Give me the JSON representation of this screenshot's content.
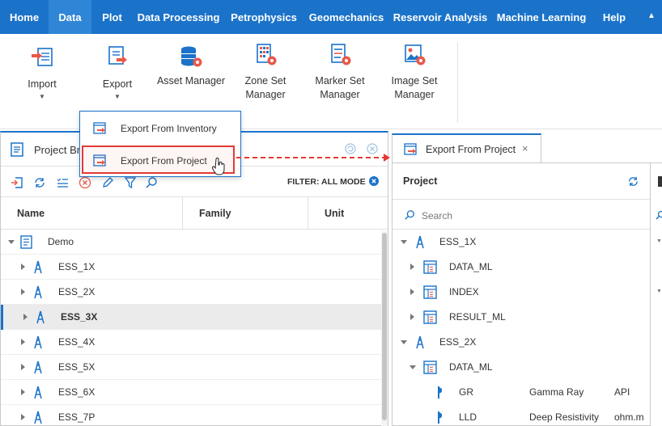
{
  "menubar": {
    "items": [
      "Home",
      "Data",
      "Plot",
      "Data Processing",
      "Petrophysics",
      "Geomechanics",
      "Reservoir Analysis",
      "Machine Learning",
      "Help"
    ],
    "active": "Data",
    "collapse_icon": "caret-up-icon"
  },
  "ribbon": {
    "import_label": "Import",
    "export_label": "Export",
    "asset_manager_label": "Asset Manager",
    "zone_set_label_1": "Zone Set",
    "zone_set_label_2": "Manager",
    "marker_set_label_1": "Marker Set",
    "marker_set_label_2": "Manager",
    "image_set_label_1": "Image Set",
    "image_set_label_2": "Manager"
  },
  "export_menu": {
    "items": [
      "Export From Inventory",
      "Export From Project"
    ],
    "highlighted": "Export From Project"
  },
  "project_browser": {
    "title": "Project Br",
    "filter_label": "FILTER: ALL MODE",
    "columns": [
      "Name",
      "Family",
      "Unit"
    ],
    "root": "Demo",
    "wells": [
      "ESS_1X",
      "ESS_2X",
      "ESS_3X",
      "ESS_4X",
      "ESS_5X",
      "ESS_6X",
      "ESS_7P"
    ],
    "selected": "ESS_3X"
  },
  "export_panel": {
    "tab_label": "Export From Project",
    "tab_close": "×",
    "header": "Project",
    "search_placeholder": "Search",
    "tree": [
      {
        "level": 0,
        "type": "well",
        "name": "ESS_1X",
        "expanded": true
      },
      {
        "level": 1,
        "type": "dataset",
        "name": "DATA_ML",
        "expanded": false
      },
      {
        "level": 1,
        "type": "dataset",
        "name": "INDEX",
        "expanded": false
      },
      {
        "level": 1,
        "type": "dataset",
        "name": "RESULT_ML",
        "expanded": false
      },
      {
        "level": 0,
        "type": "well",
        "name": "ESS_2X",
        "expanded": true
      },
      {
        "level": 1,
        "type": "dataset",
        "name": "DATA_ML",
        "expanded": true
      },
      {
        "level": 2,
        "type": "curve",
        "name": "GR",
        "family": "Gamma Ray",
        "unit": "API"
      },
      {
        "level": 2,
        "type": "curve",
        "name": "LLD",
        "family": "Deep Resistivity",
        "unit": "ohm.m"
      }
    ]
  },
  "colors": {
    "menubar": "#1b73c9",
    "menubar_active": "#2f86d6",
    "accent": "#1b73c9",
    "highlight": "#e53935",
    "icon_red": "#e8594a"
  }
}
